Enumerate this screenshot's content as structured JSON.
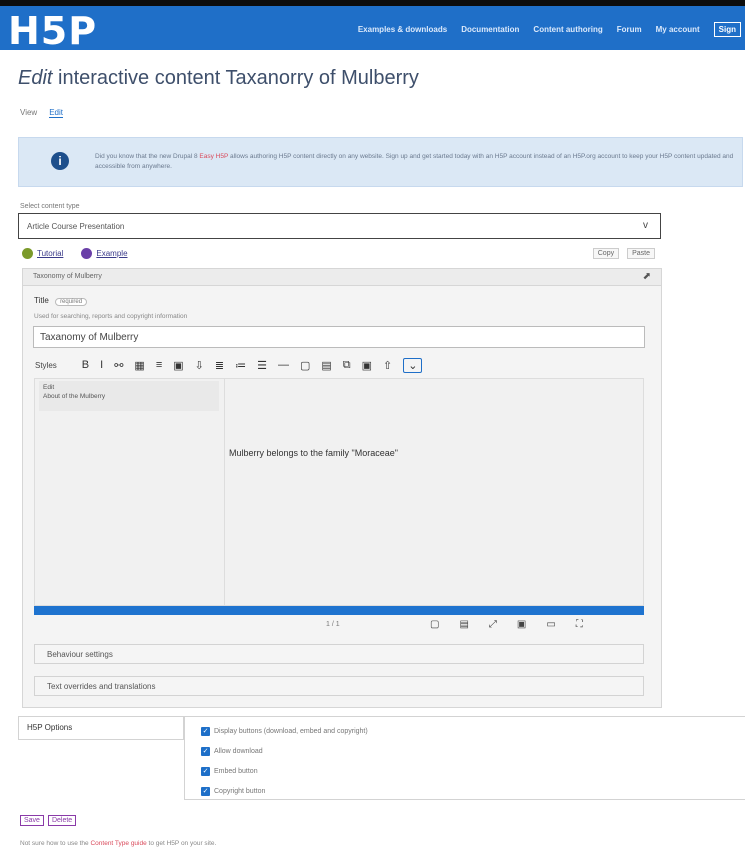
{
  "header": {
    "logo": "H5P",
    "nav": [
      "Examples & downloads",
      "Documentation",
      "Content authoring",
      "Forum",
      "My account"
    ],
    "signin": "Sign"
  },
  "page": {
    "title_em": "Edit",
    "title_rest": " interactive content Taxanorry of Mulberry",
    "tabs": [
      "View",
      "Edit"
    ]
  },
  "info": {
    "icon": "i",
    "text_a": "Did you know that the new Drupal 8 ",
    "highlight": "Easy H5P",
    "text_b": " allows authoring H5P content directly on any website. Sign up and get started today with an H5P account instead of an H5P.org account to keep your H5P content updated and accessible from anywhere."
  },
  "editor": {
    "library_label": "Select content type",
    "library_value": "Article   Course Presentation",
    "chevron": "v",
    "tutorial": "Tutorial",
    "example": "Example",
    "right_actions": [
      "Copy",
      "Paste"
    ],
    "panel_title": "Taxonomy of Mulberry",
    "pin": "⬈",
    "field_title": "Title",
    "field_required": "required",
    "field_desc": "Used for searching, reports and copyright information",
    "title_value": "Taxanomy of Mulberry",
    "style_label": "Styles",
    "toolbar": [
      "B",
      "I",
      "⚯",
      "▦",
      "≡",
      "▣",
      "⇩",
      "≣",
      "≔",
      "☰",
      "—",
      "▢",
      "▤",
      "⧉",
      "▣",
      "⇧",
      "⌄"
    ],
    "side_items": [
      "Edit",
      "About of the Mulberry"
    ],
    "content_text": "Mulberry belongs to the family \"Moraceae\"",
    "page_indicator": "1 / 1",
    "bottom_icons": [
      "▢",
      "▤",
      "⤢",
      "▣",
      "▭",
      "⛶"
    ],
    "collapsers": [
      "Behaviour settings",
      "Text overrides and translations"
    ]
  },
  "options": {
    "heading": "H5P Options",
    "items": [
      "Display buttons (download, embed and copyright)",
      "Allow download",
      "Embed button",
      "Copyright button"
    ]
  },
  "footer": {
    "buttons": [
      "Save",
      "Delete"
    ],
    "note_a": "Not sure how to use the ",
    "note_link": "Content Type guide",
    "note_b": " to get H5P on your site."
  },
  "colors": {
    "brand": "#1f6fc8",
    "progress": "#1e73cf",
    "checkbox": "#1e6fc8",
    "highlight": "#d94a5b"
  }
}
